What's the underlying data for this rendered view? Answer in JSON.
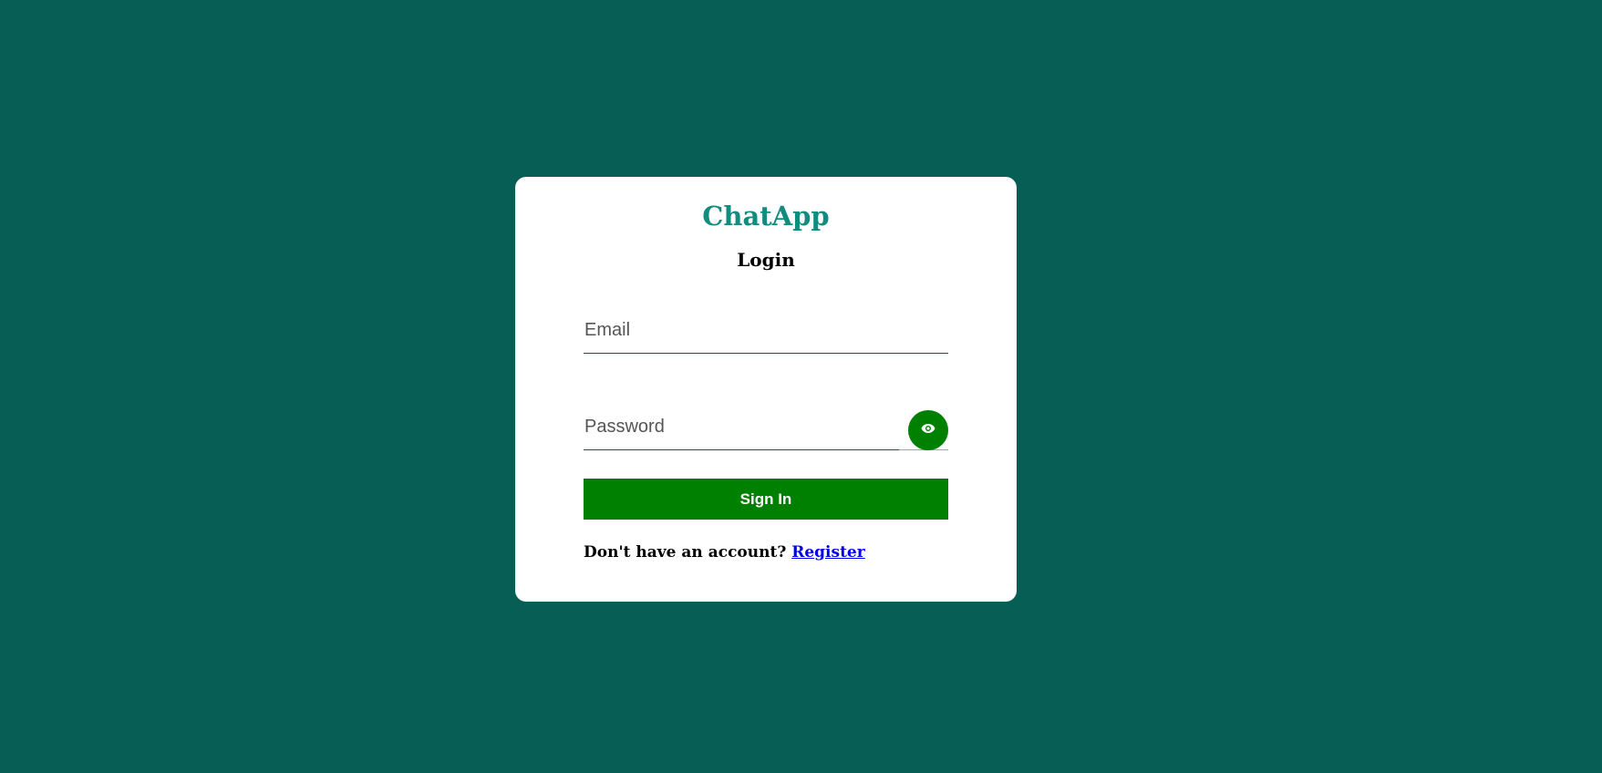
{
  "app": {
    "brand": "ChatApp",
    "heading": "Login"
  },
  "form": {
    "email_placeholder": "Email",
    "email_value": "",
    "password_placeholder": "Password",
    "password_value": "",
    "toggle_icon": "eye-icon",
    "submit_label": "Sign In"
  },
  "footer": {
    "prompt": "Don't have an account?",
    "link_label": "Register"
  },
  "colors": {
    "background": "#075e54",
    "brand": "#128c7e",
    "button": "#008000",
    "link": "#0000ee"
  }
}
